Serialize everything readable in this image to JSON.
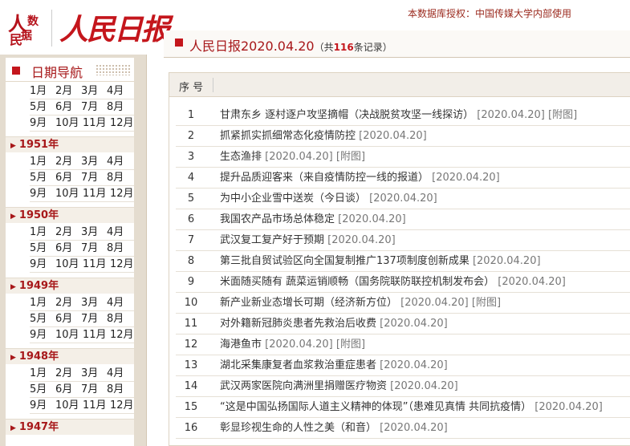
{
  "header": {
    "logo": "人民数据",
    "brand": "人民日报",
    "license": "本数据库授权：中国传媒大学内部使用"
  },
  "sidebar": {
    "title": "日期导航",
    "first_months": [
      [
        "1月",
        "2月",
        "3月",
        "4月"
      ],
      [
        "5月",
        "6月",
        "7月",
        "8月"
      ],
      [
        "9月",
        "10月",
        "11月",
        "12月"
      ]
    ],
    "years": [
      {
        "label": "1951年",
        "months": [
          [
            "1月",
            "2月",
            "3月",
            "4月"
          ],
          [
            "5月",
            "6月",
            "7月",
            "8月"
          ],
          [
            "9月",
            "10月",
            "11月",
            "12月"
          ]
        ]
      },
      {
        "label": "1950年",
        "months": [
          [
            "1月",
            "2月",
            "3月",
            "4月"
          ],
          [
            "5月",
            "6月",
            "7月",
            "8月"
          ],
          [
            "9月",
            "10月",
            "11月",
            "12月"
          ]
        ]
      },
      {
        "label": "1949年",
        "months": [
          [
            "1月",
            "2月",
            "3月",
            "4月"
          ],
          [
            "5月",
            "6月",
            "7月",
            "8月"
          ],
          [
            "9月",
            "10月",
            "11月",
            "12月"
          ]
        ]
      },
      {
        "label": "1948年",
        "months": [
          [
            "1月",
            "2月",
            "3月",
            "4月"
          ],
          [
            "5月",
            "6月",
            "7月",
            "8月"
          ],
          [
            "9月",
            "10月",
            "11月",
            "12月"
          ]
        ]
      },
      {
        "label": "1947年",
        "months": []
      }
    ]
  },
  "main": {
    "title": "人民日报2020.04.20",
    "count_prefix": "（共",
    "count": "116",
    "count_suffix": "条记录）",
    "column_header": "序 号",
    "items": [
      {
        "n": "1",
        "title": "甘肃东乡 逐村逐户攻坚摘帽（决战脱贫攻坚一线探访）",
        "date": "[2020.04.20]",
        "fig": "[附图]"
      },
      {
        "n": "2",
        "title": "抓紧抓实抓细常态化疫情防控",
        "date": "[2020.04.20]",
        "fig": ""
      },
      {
        "n": "3",
        "title": "生态渔排",
        "date": "[2020.04.20]",
        "fig": "[附图]"
      },
      {
        "n": "4",
        "title": "提升品质迎客来（来自疫情防控一线的报道）",
        "date": "[2020.04.20]",
        "fig": ""
      },
      {
        "n": "5",
        "title": "为中小企业雪中送炭（今日谈）",
        "date": "[2020.04.20]",
        "fig": ""
      },
      {
        "n": "6",
        "title": "我国农产品市场总体稳定",
        "date": "[2020.04.20]",
        "fig": ""
      },
      {
        "n": "7",
        "title": "武汉复工复产好于预期",
        "date": "[2020.04.20]",
        "fig": ""
      },
      {
        "n": "8",
        "title": "第三批自贸试验区向全国复制推广137项制度创新成果",
        "date": "[2020.04.20]",
        "fig": ""
      },
      {
        "n": "9",
        "title": "米面随买随有 蔬菜运销顺畅（国务院联防联控机制发布会）",
        "date": "[2020.04.20]",
        "fig": ""
      },
      {
        "n": "10",
        "title": "新产业新业态增长可期（经济新方位）",
        "date": "[2020.04.20]",
        "fig": "[附图]"
      },
      {
        "n": "11",
        "title": "对外籍新冠肺炎患者先救治后收费",
        "date": "[2020.04.20]",
        "fig": ""
      },
      {
        "n": "12",
        "title": "海港鱼市",
        "date": "[2020.04.20]",
        "fig": "[附图]"
      },
      {
        "n": "13",
        "title": "湖北采集康复者血浆救治重症患者",
        "date": "[2020.04.20]",
        "fig": ""
      },
      {
        "n": "14",
        "title": "武汉两家医院向满洲里捐赠医疗物资",
        "date": "[2020.04.20]",
        "fig": ""
      },
      {
        "n": "15",
        "title": "“这是中国弘扬国际人道主义精神的体现”（患难见真情 共同抗疫情）",
        "date": "[2020.04.20]",
        "fig": ""
      },
      {
        "n": "16",
        "title": "彰显珍视生命的人性之美（和音）",
        "date": "[2020.04.20]",
        "fig": ""
      }
    ]
  }
}
